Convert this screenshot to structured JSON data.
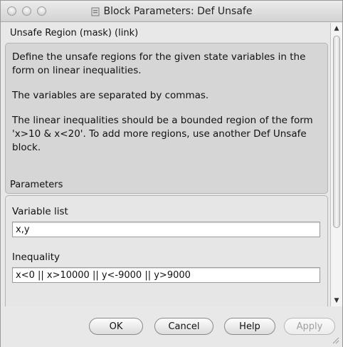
{
  "window": {
    "title": "Block Parameters: Def Unsafe"
  },
  "description": {
    "header": "Unsafe Region (mask) (link)",
    "paragraphs": [
      "Define the unsafe regions for the given state variables in the form on linear inequalities.",
      "The variables are separated by commas.",
      "The linear inequalities should be a bounded region of the form 'x>10 & x<20'. To add more regions, use another Def Unsafe block."
    ]
  },
  "parameters": {
    "header": "Parameters",
    "variable_list": {
      "label": "Variable list",
      "value": "x,y"
    },
    "inequality": {
      "label": "Inequality",
      "value": "x<0 || x>10000 || y<-9000 || y>9000"
    }
  },
  "buttons": {
    "ok": "OK",
    "cancel": "Cancel",
    "help": "Help",
    "apply": "Apply"
  },
  "scroll": {
    "up_icon": "▲",
    "down_icon": "▼",
    "position": 0.0
  }
}
